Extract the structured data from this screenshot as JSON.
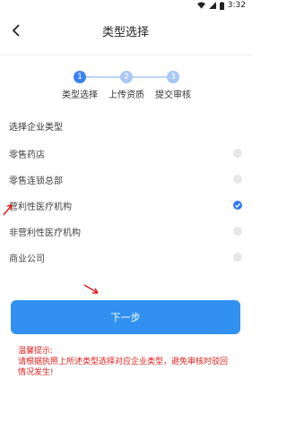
{
  "status_bar": {
    "time": "3:32"
  },
  "header": {
    "title": "类型选择"
  },
  "stepper": {
    "steps": [
      {
        "num": "1",
        "label": "类型选择"
      },
      {
        "num": "2",
        "label": "上传资质"
      },
      {
        "num": "3",
        "label": "提交审核"
      }
    ]
  },
  "section": {
    "title": "选择企业类型"
  },
  "options": [
    {
      "label": "零售药店",
      "selected": false
    },
    {
      "label": "零售连锁总部",
      "selected": false
    },
    {
      "label": "营利性医疗机构",
      "selected": true
    },
    {
      "label": "非营利性医疗机构",
      "selected": false
    },
    {
      "label": "商业公司",
      "selected": false
    }
  ],
  "next_button": {
    "label": "下一步"
  },
  "notice": {
    "heading": "温馨提示:",
    "line1": "请根据执照上所述类型选择对应企业类型，避免审核时驳回",
    "line2": "情况发生!"
  },
  "colors": {
    "primary": "#3291f0",
    "notice": "#e21d1d",
    "annotation": "#e21d1d"
  }
}
